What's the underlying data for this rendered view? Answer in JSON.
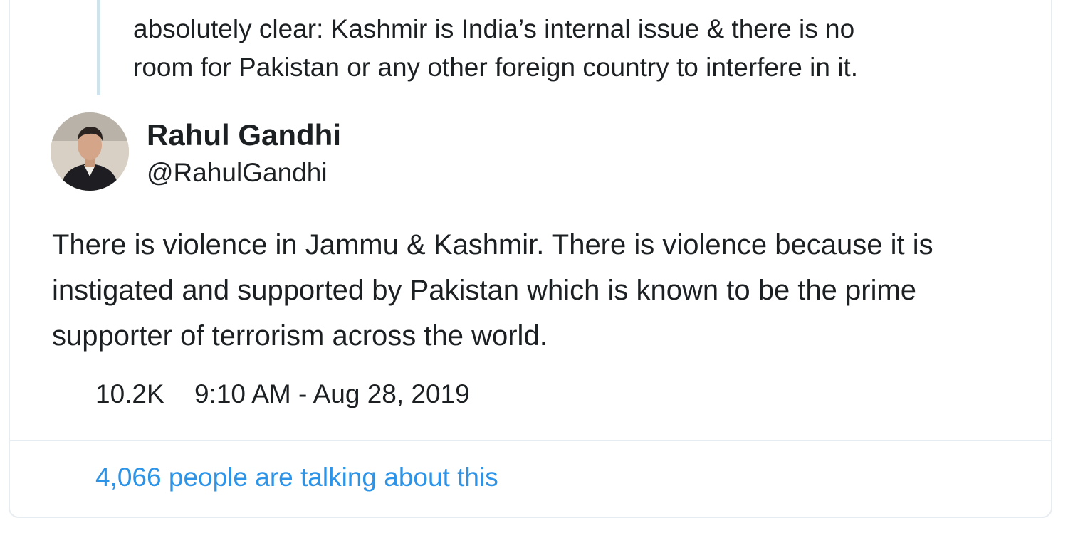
{
  "parent_tweet": {
    "text_lines": [
      "absolutely clear: Kashmir is India’s internal issue & there is no",
      "room for Pakistan or any other foreign country to interfere in it."
    ]
  },
  "tweet": {
    "author_name": "Rahul Gandhi",
    "author_handle": "@RahulGandhi",
    "avatar_icon": "user-avatar",
    "text": "There is violence in Jammu & Kashmir. There is violence because it is instigated and supported by Pakistan which is known to be the prime supporter of terrorism across the world.",
    "likes": "10.2K",
    "timestamp": "9:10 AM - Aug 28, 2019"
  },
  "footer": {
    "talking_label": "4,066 people are talking about this"
  },
  "colors": {
    "link_blue": "#2b93e8",
    "border": "#e6ecf0",
    "thread_line": "#cfe3ed",
    "text": "#1c2022"
  }
}
